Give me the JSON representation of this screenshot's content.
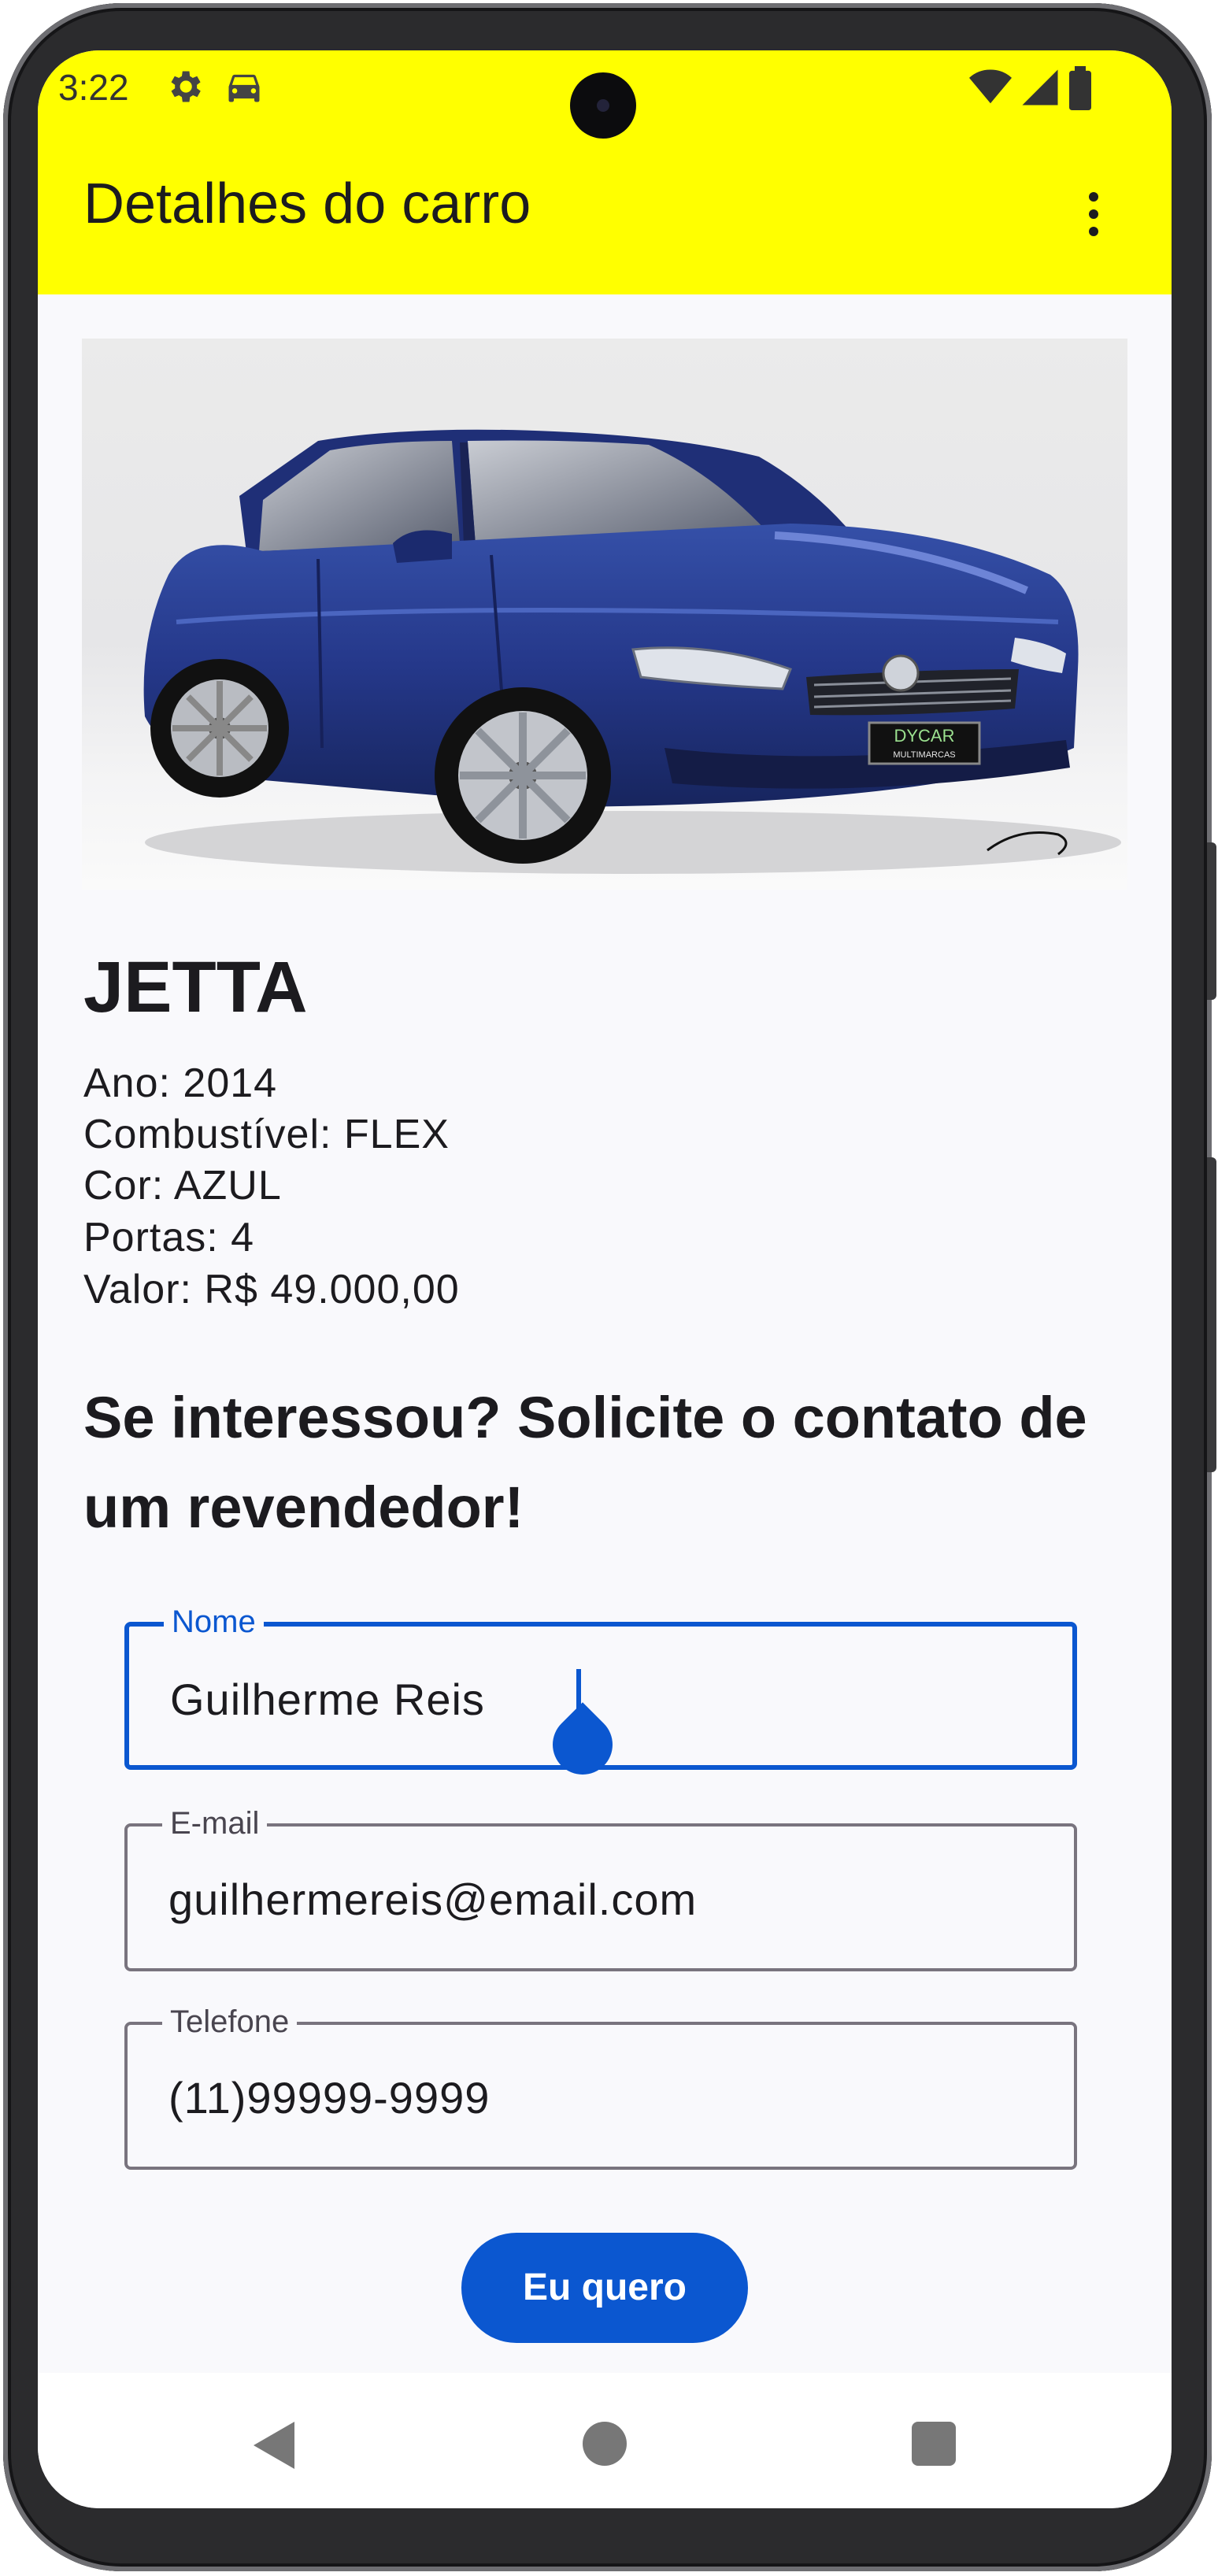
{
  "status_bar": {
    "time": "3:22",
    "left_icons": [
      "gear-icon",
      "car-icon"
    ],
    "right_icons": [
      "wifi-icon",
      "signal-icon",
      "battery-icon"
    ]
  },
  "app_bar": {
    "title": "Detalhes do carro",
    "menu_icon": "more-vert-icon",
    "color": "#ffff00"
  },
  "car": {
    "name": "JETTA",
    "specs": [
      "Ano: 2014",
      "Combustível: FLEX",
      "Cor: AZUL",
      "Portas: 4",
      "Valor: R$ 49.000,00"
    ],
    "plate_brand": "DYCAR",
    "plate_sub": "MULTIMARCAS"
  },
  "contact": {
    "heading": "Se interessou? Solicite o contato de um revendedor!",
    "fields": [
      {
        "label": "Nome",
        "value": "Guilherme Reis",
        "focused": true
      },
      {
        "label": "E-mail",
        "value": "guilhermereis@email.com",
        "focused": false
      },
      {
        "label": "Telefone",
        "value": "(11)99999-9999",
        "focused": false
      }
    ],
    "submit_label": "Eu quero"
  },
  "nav_bar": {
    "icons": [
      "back-icon",
      "home-icon",
      "recents-icon"
    ]
  },
  "colors": {
    "accent": "#0b57d0",
    "app_bar": "#ffff00",
    "background": "#f9f9fc",
    "car_body": "#2a3f93"
  }
}
